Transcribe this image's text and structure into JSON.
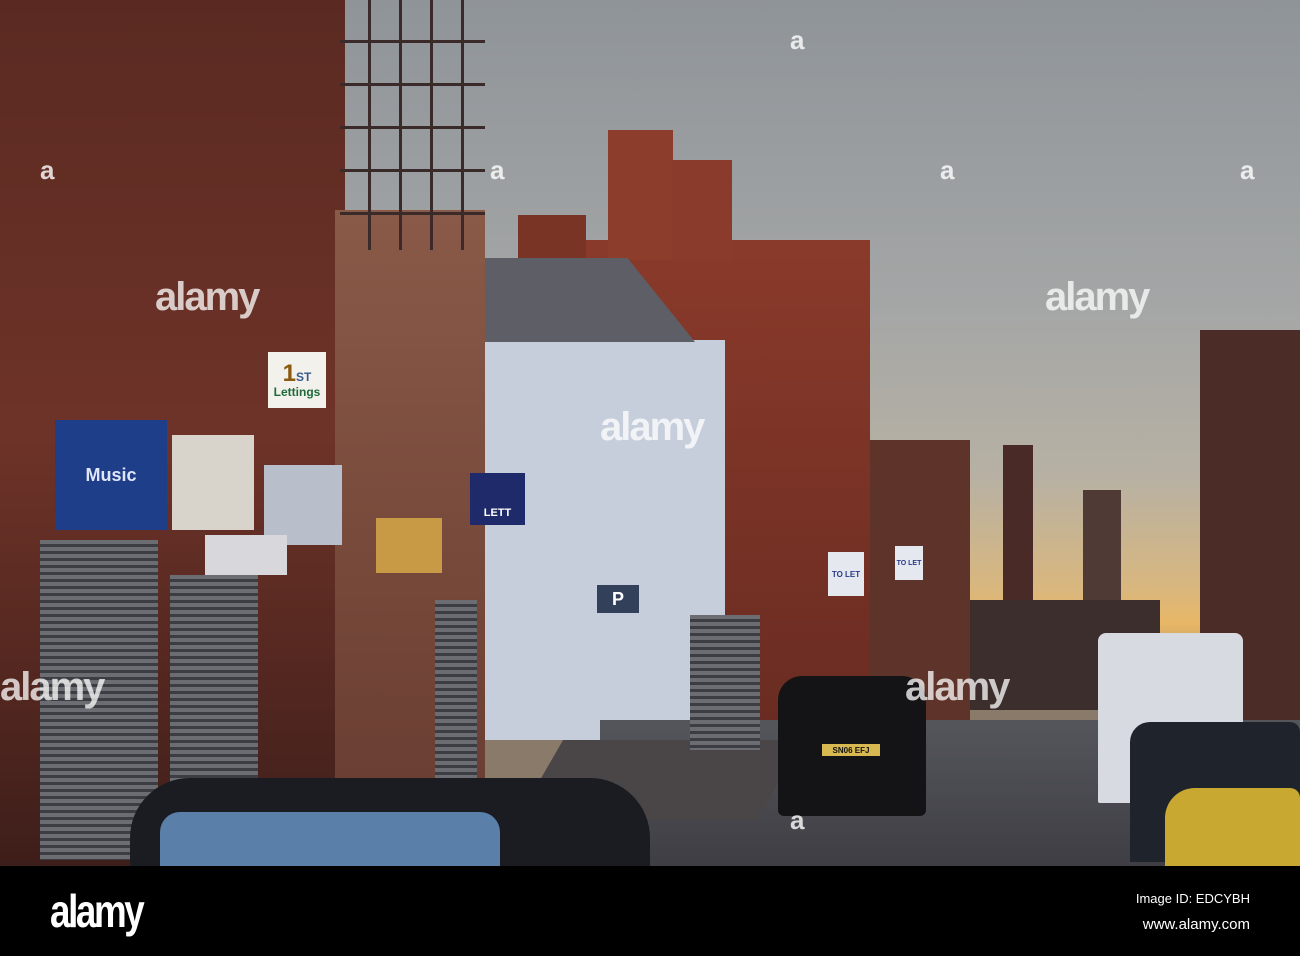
{
  "signs": {
    "first_lettings_number": "1",
    "first_lettings_suffix": "ST",
    "first_lettings_word": "Lettings",
    "music_shop": "Music",
    "four_m_lettings": "LETT",
    "to_let_1": "TO LET",
    "to_let_2": "TO LET",
    "parking": "P",
    "taxi_plate": "SN06 EFJ"
  },
  "watermark": {
    "text": "alamy",
    "letter": "a"
  },
  "footer": {
    "logo": "alamy",
    "image_id": "Image ID: EDCYBH",
    "url": "www.alamy.com"
  }
}
